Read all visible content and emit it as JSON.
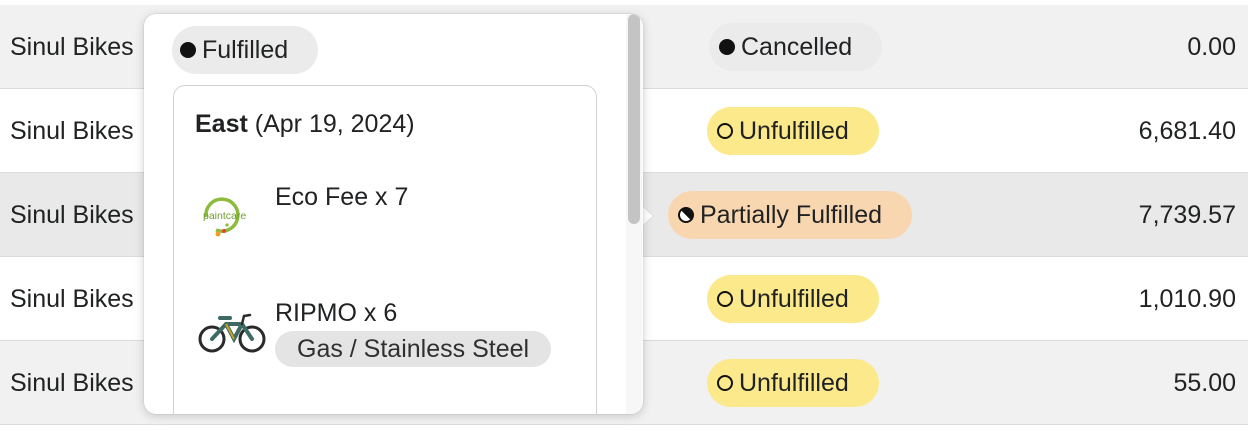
{
  "rows": [
    {
      "customer": "Sinul Bikes",
      "status": "Cancelled",
      "amount": "0.00"
    },
    {
      "customer": "Sinul Bikes",
      "status": "Unfulfilled",
      "amount": "6,681.40"
    },
    {
      "customer": "Sinul Bikes",
      "status": "Partially Fulfilled",
      "amount": "7,739.57"
    },
    {
      "customer": "Sinul Bikes",
      "status": "Unfulfilled",
      "amount": "1,010.90"
    },
    {
      "customer": "Sinul Bikes",
      "status": "Unfulfilled",
      "amount": "55.00"
    }
  ],
  "popover": {
    "badge": "Fulfilled",
    "location_name": "East",
    "location_date": "(Apr 19, 2024)",
    "items": [
      {
        "name": "Eco Fee x 7",
        "thumbnail": "paintcare-logo",
        "logo_text": "paintcare"
      },
      {
        "name": "RIPMO x 6",
        "thumbnail": "mountain-bike-image",
        "variant": "Gas / Stainless Steel"
      }
    ]
  },
  "colors": {
    "cancelled_bg": "#ebebeb",
    "unfulfilled_bg": "#fbe98c",
    "partial_bg": "#f8d7b0",
    "paintcare_green": "#8dbb3e"
  }
}
